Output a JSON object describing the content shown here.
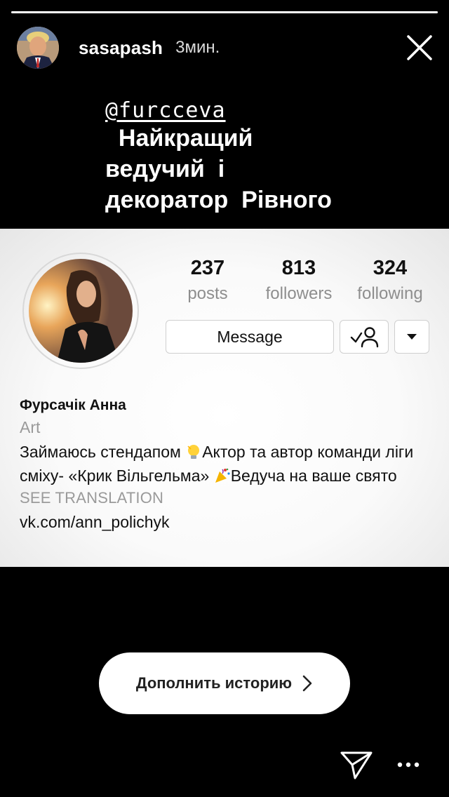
{
  "story": {
    "progress": 1.0,
    "username": "sasapash",
    "time": "3мин.",
    "mention": "@furcceva",
    "caption_lines": [
      "  Найкращий",
      "ведучий  і",
      "декоратор  Рівного"
    ]
  },
  "profile": {
    "stats": [
      {
        "value": "237",
        "label": "posts"
      },
      {
        "value": "813",
        "label": "followers"
      },
      {
        "value": "324",
        "label": "following"
      }
    ],
    "message_label": "Message",
    "name": "Фурсачік Анна",
    "category": "Art",
    "bio_part1": " Займаюсь стендапом ",
    "bio_part2": "Актор та автор команди ліги сміху- «Крик Вільгельма» ",
    "bio_part3": "Ведуча на ваше свято",
    "see_translation": "SEE TRANSLATION",
    "link": "vk.com/ann_polichyk"
  },
  "footer": {
    "add_story_label": "Дополнить историю"
  },
  "icons": {
    "close": "close-icon",
    "send": "send-icon",
    "more": "more-dots-icon"
  }
}
